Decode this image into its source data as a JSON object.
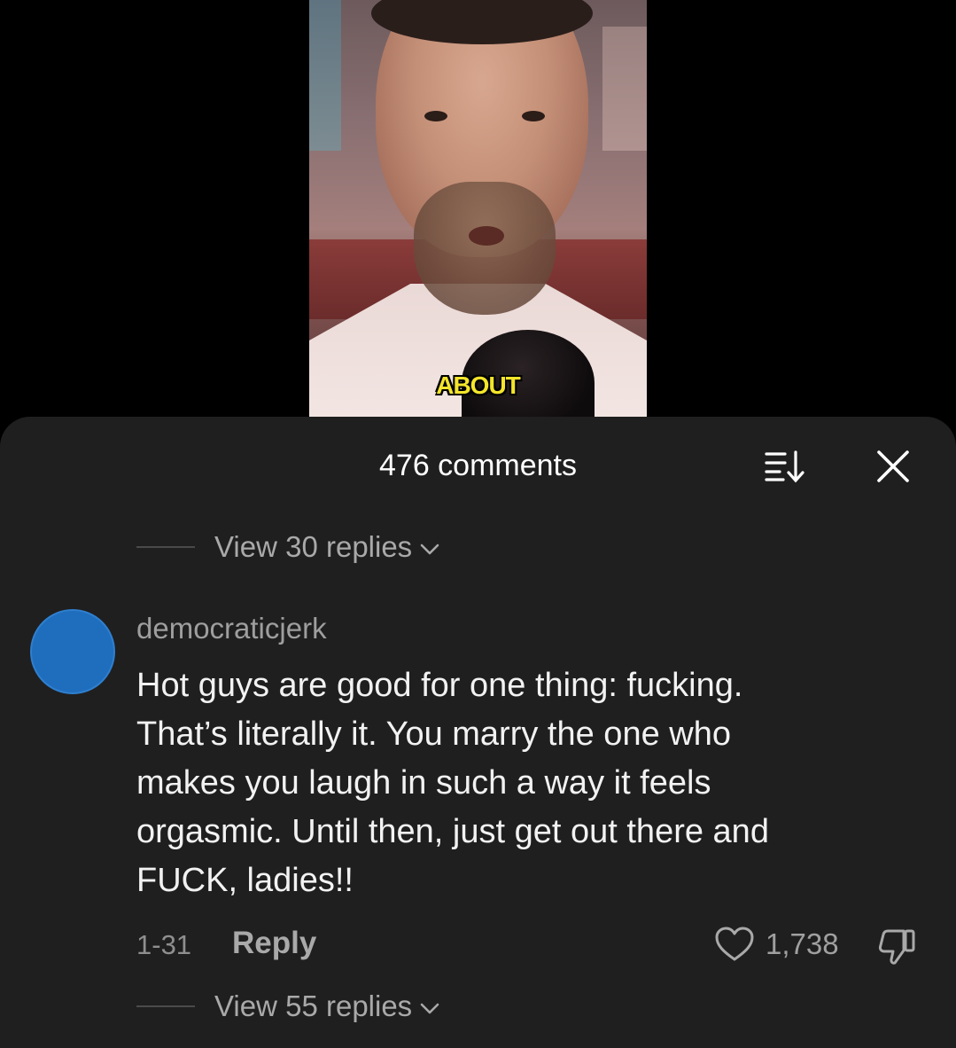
{
  "video": {
    "caption": "ABOUT"
  },
  "sheet": {
    "title": "476 comments",
    "sort_icon": "sort-icon",
    "close_icon": "close-icon"
  },
  "thread_top": {
    "view_replies_label": "View 30 replies"
  },
  "comment": {
    "username": "democraticjerk",
    "avatar_color": "#1f6ebd",
    "lines": [
      "Hot guys are good for one thing: fucking.",
      "That’s literally it. You marry the one who",
      "makes you laugh in such a way it feels",
      "orgasmic. Until then, just get out there and",
      "FUCK, ladies!!"
    ],
    "date": "1-31",
    "reply_label": "Reply",
    "like_count": "1,738",
    "view_replies_label": "View 55 replies"
  },
  "colors": {
    "sheet_bg": "#1f1f1f",
    "caption_yellow": "#f4e52b",
    "muted_text": "#a9a9a9"
  }
}
